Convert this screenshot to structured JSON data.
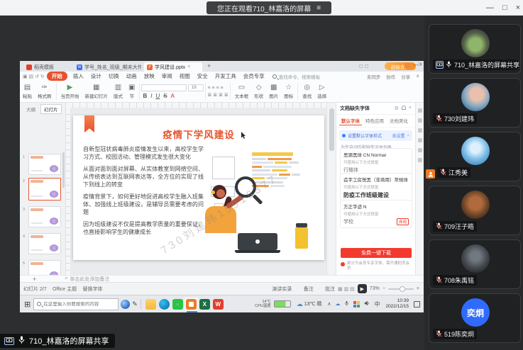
{
  "meeting": {
    "banner": "您正在观看710_林嘉洛的屏幕",
    "banner_menu_glyph": "≡",
    "share_overlay": "710_林嘉洛的屏幕共享",
    "window_controls": {
      "minimize": "—",
      "maximize": "□",
      "close": "×"
    },
    "participants": [
      {
        "name": "710_林嘉洛的屏幕共享",
        "mic": "on",
        "sharing": true
      },
      {
        "name": "730刘建玮",
        "mic": "muted"
      },
      {
        "name": "江秀美",
        "mic": "muted",
        "host": true
      },
      {
        "name": "709汪子皓",
        "mic": "muted"
      },
      {
        "name": "708朱禹铭",
        "mic": "muted"
      },
      {
        "name": "519陈奕炯",
        "mic": "muted",
        "avatar_text": "奕炯",
        "avatar_color": "#2f6bff"
      }
    ]
  },
  "wps": {
    "doc_tabs": [
      {
        "label": "稻壳模板"
      },
      {
        "label": "学号_姓名_班级_期末大作业"
      },
      {
        "label": "学风建设.pptx",
        "active": true
      }
    ],
    "tab_close": "×",
    "new_tab": "+",
    "member_pill": "超级会员",
    "window_controls": {
      "minimize": "—",
      "maximize": "□",
      "close": "×"
    },
    "menus": [
      "开始",
      "插入",
      "设计",
      "切换",
      "动画",
      "放映",
      "审阅",
      "视图",
      "安全",
      "开发工具",
      "会员专享"
    ],
    "search_placeholder": "查找命令、搜索模板",
    "quick_actions": [
      "未同步",
      "协作",
      "分享"
    ],
    "collapse_glyph": "∧",
    "ribbon": {
      "items": [
        "粘贴",
        "格式刷",
        "当页开始",
        "新建幻灯片",
        "版式",
        "节"
      ],
      "item_glyphs": [
        "▤",
        "✑",
        "▶",
        "▦",
        "▥",
        "▣"
      ],
      "insert_items": [
        "文本框",
        "形状",
        "图片",
        "图标",
        "查找",
        "选择"
      ],
      "insert_glyphs": [
        "▭",
        "◇",
        "▩",
        "☆",
        "◎",
        "▷"
      ],
      "format_buttons": [
        "B",
        "I",
        "U",
        "S"
      ],
      "font_size": "18"
    },
    "left_tabs": [
      "大纲",
      "幻灯片"
    ],
    "thumb_numbers": [
      "1",
      "2",
      "3",
      "4",
      "5"
    ],
    "slide": {
      "title": "疫情下学风建设",
      "paragraphs": [
        "自新型冠状病毒肺炎疫情发生以来，高校学生学习方式、校园活动、管理模式发生很大变化",
        "从面对面到面对屏幕、从实体教室到网络空间、从传统表达到互联网表达等，全方位的实现了线下到线上的转变",
        "疫情背景下，如何更好地促进高校学生融入班集体、加强线上班级建设，是辅导员需要考虑的问题",
        "因为班级建设不仅是提高教学质量的重要保证，也直接影响学生的健康成长"
      ],
      "watermark": "730刘建玮15919377"
    },
    "panel": {
      "title": "文档缺失字体",
      "settings_glyph": "⚙",
      "tabs": [
        "默认字体",
        "特色应用",
        "文档美化"
      ],
      "banner_text": "设置默认字体样式",
      "banner_action": "去设置",
      "auto_line": "为您自动匹配缺失字体列表",
      "section_label": "文档缺失字体",
      "cards": [
        {
          "name": "思源黑体 CN Normal",
          "sub": "可使用以下方式修复",
          "sample": "行楷体"
        },
        {
          "name": "造字工房悦黑（非商用）常规体",
          "sub": "可使用以下方式修复",
          "sample": "防疫工作班级建设"
        },
        {
          "name": "方正字迹 N",
          "sub": "可使用以下方式修复",
          "sample": "学校",
          "tag": "商用"
        }
      ],
      "download_button": "免费一键下载",
      "note": "部分为会员专享字体，需开通稻壳会员"
    },
    "notes_placeholder": "单击此处添加备注",
    "status": {
      "slide_no": "幻灯片 2/7",
      "theme": "Office 主题",
      "replace_font": "替换字体",
      "rec": "演讲实录",
      "notes": "备注",
      "comments": "批注",
      "zoom": "73%"
    }
  },
  "taskbar": {
    "search_placeholder": "在这里输入你要搜索的内容",
    "cpu_value": "14℃",
    "cpu_label": "CPU温度",
    "weather": "13℃ 晴",
    "ime": "中",
    "time": "10:39",
    "date": "2022/12/15"
  },
  "colors": {
    "accent_red": "#e8502e",
    "member_orange": "#ff8c1a",
    "download_red": "#f23a2f",
    "banner_blue": "#3f7dff",
    "avatar_blue": "#2f6bff",
    "host_badge_orange": "#f07a24"
  }
}
